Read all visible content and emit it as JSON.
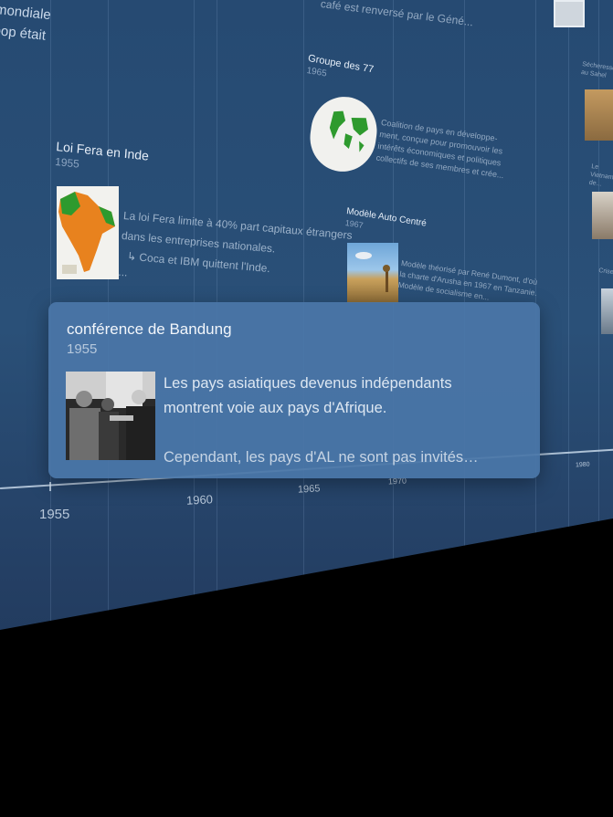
{
  "top_fragments": {
    "line1": "mondiale",
    "line2": "oop était",
    "line3": "café est renversé par le Géné..."
  },
  "events": [
    {
      "title": "Loi Fera en Inde",
      "year": "1955",
      "body_line1": "La loi Fera limite à 40% part capitaux étrangers",
      "body_line2": "dans les entreprises nationales.",
      "body_line3": "↳ Coca et IBM quittent l'Inde.",
      "body_line4": "..."
    },
    {
      "title": "Groupe des 77",
      "year": "1965",
      "body_line1": "Coalition de pays en développe-",
      "body_line2": "ment, conçue pour promouvoir les",
      "body_line3": "intérêts économiques et politiques",
      "body_line4": "collectifs de ses membres et crée..."
    },
    {
      "title": "Modèle Auto Centré",
      "year": "1967",
      "body_line1": "Modèle théorisé par René Dumont, d'où",
      "body_line2": "la charte d'Arusha en 1967 en Tanzanie.",
      "body_line3": "Modèle de socialisme en..."
    }
  ],
  "right_fragments": {
    "item1": "Sécheresse au Sahel",
    "item2": "Le Vietnam de...",
    "item3": "Crise..."
  },
  "axis": {
    "ticks": [
      "1955",
      "1960",
      "1965",
      "1970",
      "1980"
    ]
  },
  "card": {
    "title": "conférence de Bandung",
    "year": "1955",
    "photo_icon": "archival-photo",
    "text_line1": "Les pays asiatiques devenus indépendants",
    "text_line2": "montrent voie aux pays d'Afrique.",
    "text_line3": "Cependant, les pays d'AL ne sont pas invités…"
  },
  "colors": {
    "plane": "#2a5078",
    "card": "#4a76a8",
    "map_orange": "#e8821e",
    "map_green": "#2e9a2e"
  }
}
